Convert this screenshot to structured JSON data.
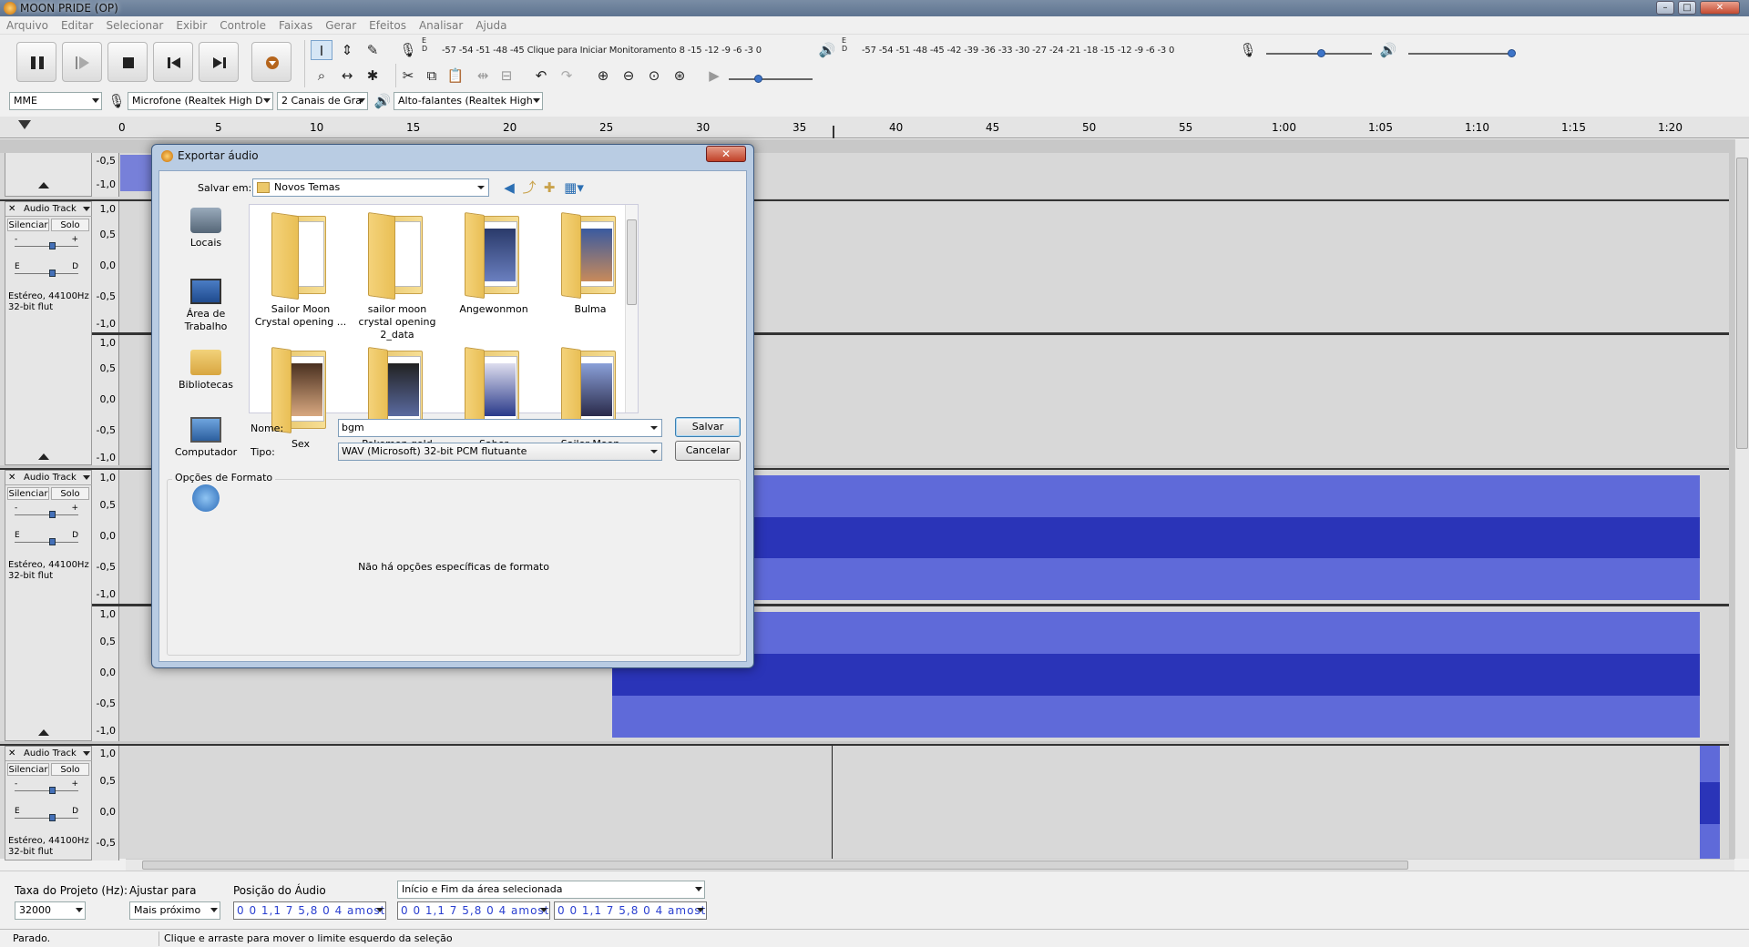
{
  "window": {
    "title": "MOON PRIDE (OP)"
  },
  "menu": [
    "Arquivo",
    "Editar",
    "Selecionar",
    "Exibir",
    "Controle",
    "Faixas",
    "Gerar",
    "Efeitos",
    "Analisar",
    "Ajuda"
  ],
  "meters": {
    "record_scale": "-57 -54 -51 -48 -45",
    "record_hint": "Clique para Iniciar Monitoramento",
    "record_tail": "8 -15 -12  -9  -6  -3  0",
    "play_scale": "-57 -54 -51 -48 -45 -42 -39 -36 -33 -30 -27 -24 -21 -18 -15 -12  -9  -6  -3  0",
    "lr_r": "E",
    "lr_d": "D"
  },
  "devices": {
    "host": "MME",
    "input": "Microfone (Realtek High D",
    "channels": "2 Canais de  Gra",
    "output": "Alto-falantes (Realtek High"
  },
  "ruler": [
    "0",
    "5",
    "10",
    "15",
    "20",
    "25",
    "30",
    "35",
    "40",
    "45",
    "50",
    "55",
    "1:00",
    "1:05",
    "1:10",
    "1:15",
    "1:20"
  ],
  "tracks": {
    "name": "Audio Track",
    "mute": "Silenciar",
    "solo": "Solo",
    "gain_minus": "-",
    "gain_plus": "+",
    "pan_left": "E",
    "pan_right": "D",
    "info1": "Estéreo, 44100Hz",
    "info2": "32-bit flut",
    "scale": [
      "1,0",
      "0,5",
      "0,0",
      "-0,5",
      "-1,0"
    ],
    "top_scale": [
      "-0,5",
      "-1,0"
    ]
  },
  "dialog": {
    "title": "Exportar áudio",
    "save_in_label": "Salvar em:",
    "save_in_value": "Novos Temas",
    "places": [
      "Locais",
      "Área de Trabalho",
      "Bibliotecas",
      "Computador"
    ],
    "folders": [
      "Sailor Moon Crystal opening ...",
      "sailor moon crystal opening 2_data",
      "Angewonmon",
      "Bulma",
      "Sex",
      "Pokemon gold",
      "Saber",
      "Sailor Moon"
    ],
    "name_label": "Nome:",
    "name_value": "bgm",
    "type_label": "Tipo:",
    "type_value": "WAV (Microsoft) 32-bit PCM flutuante",
    "save_button": "Salvar",
    "cancel_button": "Cancelar",
    "format_group": "Opções de Formato",
    "format_message": "Não há opções específicas de formato"
  },
  "bottom": {
    "rate_label": "Taxa do Projeto (Hz):",
    "rate_value": "32000",
    "snap_label": "Ajustar para",
    "snap_value": "Mais próximo",
    "pos_label": "Posição do Áudio",
    "pos_value": "0 0 1,1 7 5,8 0 4  amostras",
    "sel_mode": "Início e Fim da área selecionada",
    "sel_start": "0 0 1,1 7 5,8 0 4  amostras",
    "sel_end": "0 0 1,1 7 5,8 0 4  amostras"
  },
  "status": {
    "left": "Parado.",
    "hint": "Clique e arraste para mover o limite esquerdo da seleção"
  },
  "colors": {
    "wave": "#5f6ad9",
    "wave_peak": "#2a34b8",
    "accent": "#3d74c8"
  }
}
